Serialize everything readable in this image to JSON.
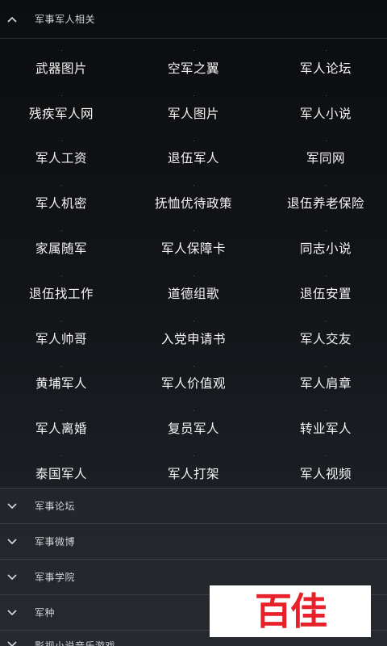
{
  "expanded_section": {
    "title": "军事军人相关",
    "items": [
      "武器图片",
      "空军之翼",
      "军人论坛",
      "残疾军人网",
      "军人图片",
      "军人小说",
      "军人工资",
      "退伍军人",
      "军同网",
      "军人机密",
      "抚恤优待政策",
      "退伍养老保险",
      "家属随军",
      "军人保障卡",
      "同志小说",
      "退伍找工作",
      "道德组歌",
      "退伍安置",
      "军人帅哥",
      "入党申请书",
      "军人交友",
      "黄埔军人",
      "军人价值观",
      "军人肩章",
      "军人离婚",
      "复员军人",
      "转业军人",
      "泰国军人",
      "军人打架",
      "军人视频"
    ]
  },
  "collapsed_sections": [
    {
      "title": "军事论坛"
    },
    {
      "title": "军事微博"
    },
    {
      "title": "军事学院"
    },
    {
      "title": "军种"
    },
    {
      "title": "影视小说音乐游戏"
    }
  ],
  "watermark": {
    "text": "百佳",
    "color": "#e8202a"
  },
  "colors": {
    "background_top": "#0c0d0f",
    "background_bottom": "#25282d",
    "text": "#f5f5f5"
  }
}
